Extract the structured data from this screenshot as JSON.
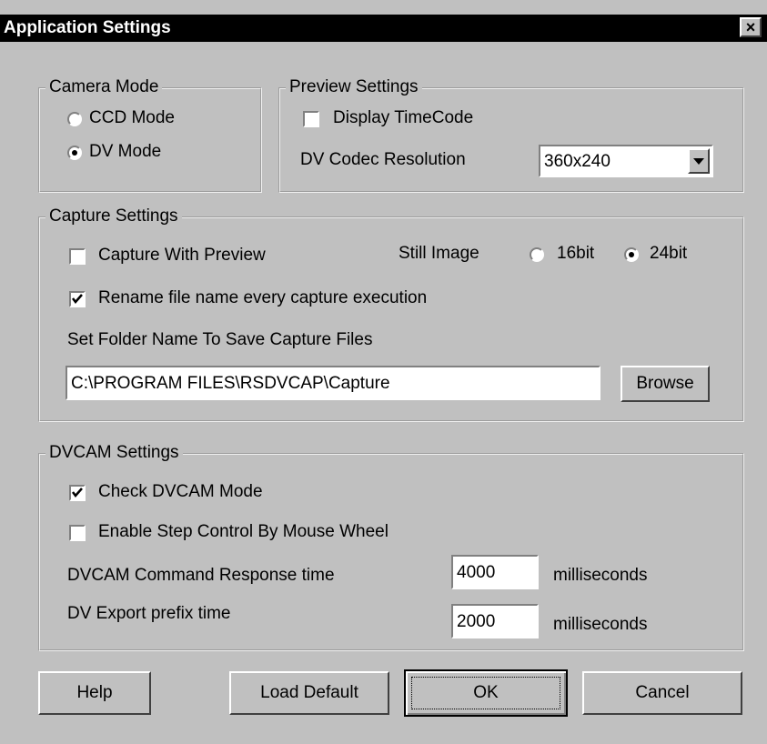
{
  "window": {
    "title": "Application Settings",
    "close_glyph": "×"
  },
  "camera_mode": {
    "legend": "Camera Mode",
    "options": [
      {
        "label": "CCD Mode",
        "selected": false
      },
      {
        "label": "DV Mode",
        "selected": true
      }
    ]
  },
  "preview_settings": {
    "legend": "Preview Settings",
    "display_timecode": {
      "label": "Display TimeCode",
      "checked": false
    },
    "codec_resolution": {
      "label": "DV Codec Resolution",
      "value": "360x240"
    }
  },
  "capture_settings": {
    "legend": "Capture Settings",
    "capture_with_preview": {
      "label": "Capture With Preview",
      "checked": false
    },
    "still_image": {
      "label": "Still Image",
      "options": [
        {
          "label": "16bit",
          "selected": false
        },
        {
          "label": "24bit",
          "selected": true
        }
      ]
    },
    "rename_file": {
      "label": "Rename file name every capture execution",
      "checked": true
    },
    "folder_label": "Set Folder Name To Save Capture Files",
    "folder_path": "C:\\PROGRAM FILES\\RSDVCAP\\Capture",
    "browse_label": "Browse"
  },
  "dvcam_settings": {
    "legend": "DVCAM Settings",
    "check_dvcam": {
      "label": "Check DVCAM Mode",
      "checked": true
    },
    "step_control": {
      "label": "Enable Step Control By Mouse Wheel",
      "checked": false
    },
    "response_time": {
      "label": "DVCAM Command Response time",
      "value": "4000",
      "unit": "milliseconds"
    },
    "export_prefix": {
      "label": "DV Export prefix time",
      "value": "2000",
      "unit": "milliseconds"
    }
  },
  "buttons": {
    "help": "Help",
    "load_default": "Load Default",
    "ok": "OK",
    "cancel": "Cancel"
  }
}
